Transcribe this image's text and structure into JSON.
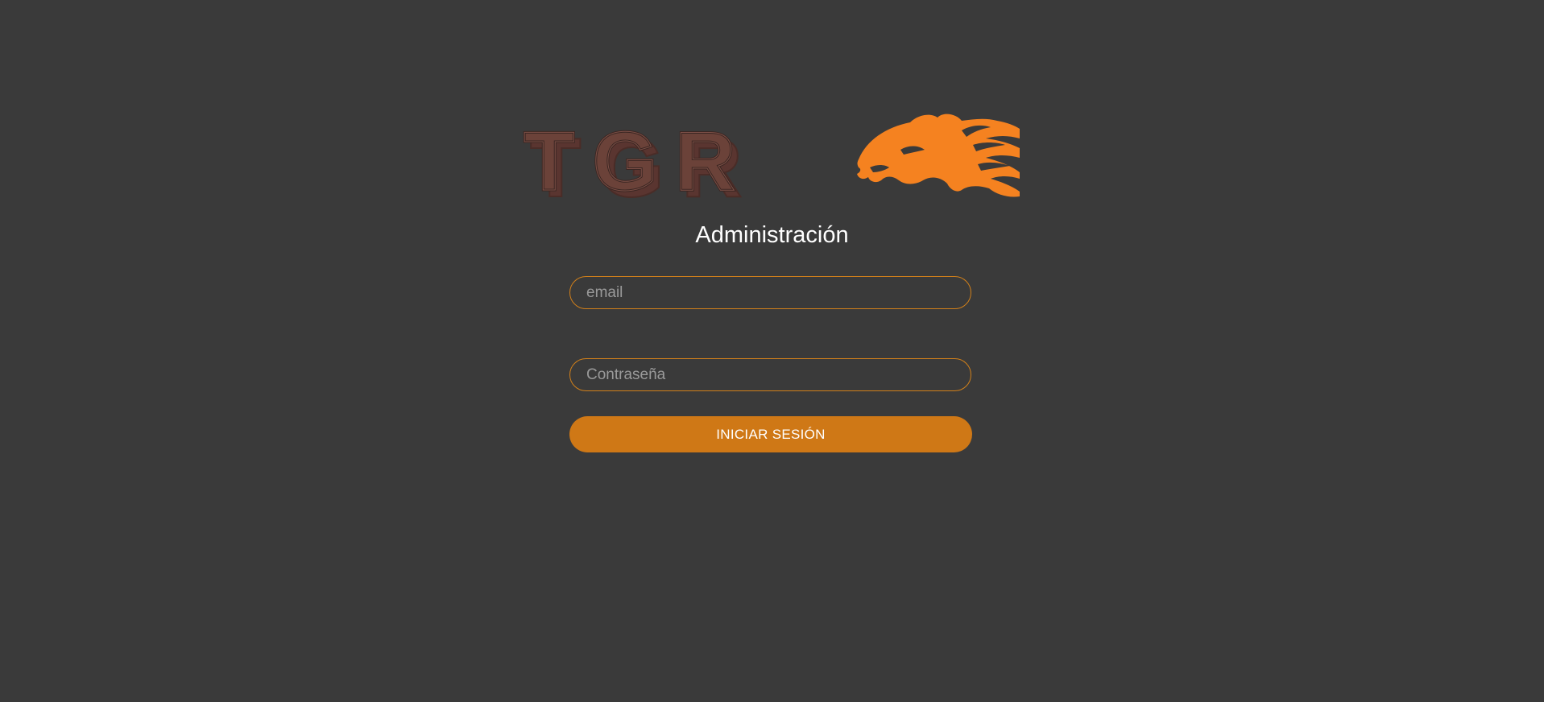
{
  "brand": {
    "logo_text": "TGR",
    "logo_icon": "flaming-jaguar-icon",
    "accent_color": "#f58220",
    "logo_text_color": "#6b4239"
  },
  "login": {
    "title": "Administración",
    "email_placeholder": "email",
    "password_placeholder": "Contraseña",
    "submit_label": "INICIAR SESIÓN",
    "button_color": "#cf7816",
    "border_color": "#d2801a",
    "background_color": "#3a3a3a"
  }
}
